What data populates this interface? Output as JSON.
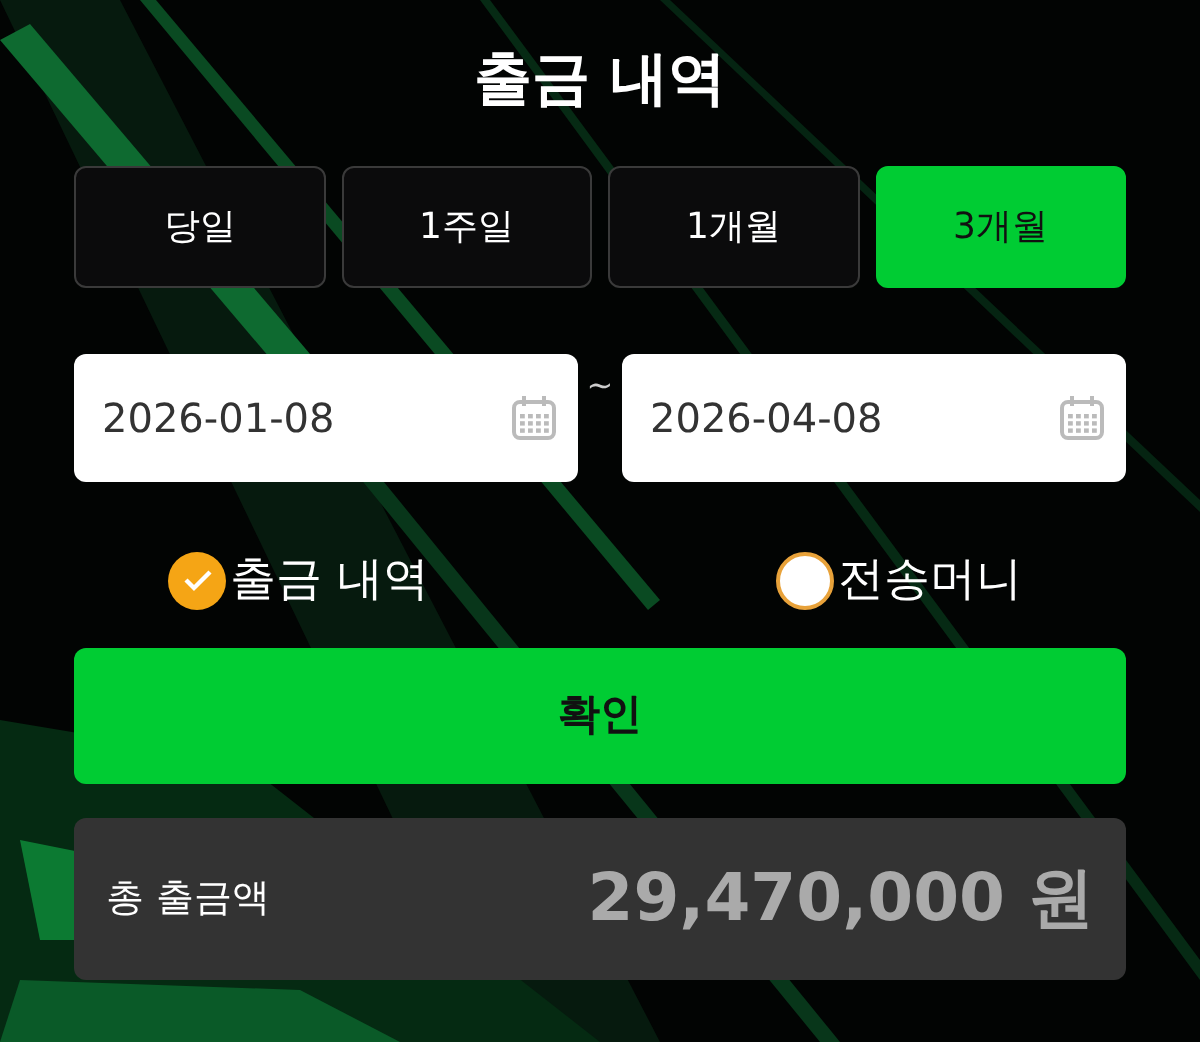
{
  "title": "출금 내역",
  "periods": [
    {
      "label": "당일",
      "selected": false
    },
    {
      "label": "1주일",
      "selected": false
    },
    {
      "label": "1개월",
      "selected": false
    },
    {
      "label": "3개월",
      "selected": true
    }
  ],
  "date_range": {
    "start": "2026-01-08",
    "separator": "~",
    "end": "2026-04-08"
  },
  "options": [
    {
      "label": "출금 내역",
      "selected": true
    },
    {
      "label": "전송머니",
      "selected": false
    }
  ],
  "confirm_button": "확인",
  "total": {
    "label": "총 출금액",
    "value": "29,470,000 원"
  }
}
